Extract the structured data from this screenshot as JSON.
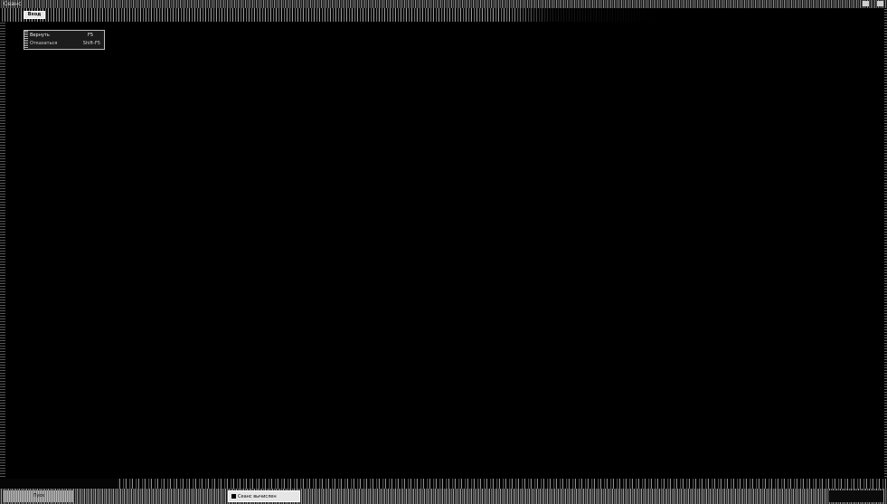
{
  "window": {
    "title": "Сеанс"
  },
  "toolbar": {
    "menu_label": "Вход"
  },
  "popup": {
    "items": [
      {
        "label": "Вернуть",
        "key": "F5"
      },
      {
        "label": "Отказаться",
        "key": "Shift-F5"
      }
    ]
  },
  "taskbar": {
    "start_label": "Пуск",
    "active_task_label": "Сеанс вычислен",
    "other_task_label": "",
    "tray_text": ""
  }
}
